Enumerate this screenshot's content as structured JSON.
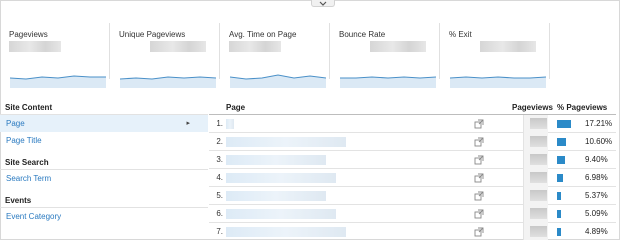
{
  "metrics": [
    {
      "label": "Pageviews"
    },
    {
      "label": "Unique Pageviews"
    },
    {
      "label": "Avg. Time on Page"
    },
    {
      "label": "Bounce Rate"
    },
    {
      "label": "% Exit"
    }
  ],
  "colors": {
    "accent": "#2a7ac0",
    "bar": "#2b8ac8",
    "sparkline": "#4a90c8",
    "sparkfill": "#dbe9f5",
    "active_bg": "#e6f1fa"
  },
  "nav": {
    "site_content": {
      "heading": "Site Content",
      "items": [
        "Page",
        "Page Title"
      ]
    },
    "site_search": {
      "heading": "Site Search",
      "items": [
        "Search Term"
      ]
    },
    "events": {
      "heading": "Events",
      "items": [
        "Event Category"
      ]
    }
  },
  "table": {
    "headers": {
      "page": "Page",
      "pageviews": "Pageviews",
      "pct": "% Pageviews"
    },
    "rows": [
      {
        "idx": "1.",
        "pct": "17.21%",
        "share": 17.21
      },
      {
        "idx": "2.",
        "pct": "10.60%",
        "share": 10.6
      },
      {
        "idx": "3.",
        "pct": "9.40%",
        "share": 9.4
      },
      {
        "idx": "4.",
        "pct": "6.98%",
        "share": 6.98
      },
      {
        "idx": "5.",
        "pct": "5.37%",
        "share": 5.37
      },
      {
        "idx": "6.",
        "pct": "5.09%",
        "share": 5.09
      },
      {
        "idx": "7.",
        "pct": "4.89%",
        "share": 4.89
      }
    ]
  }
}
